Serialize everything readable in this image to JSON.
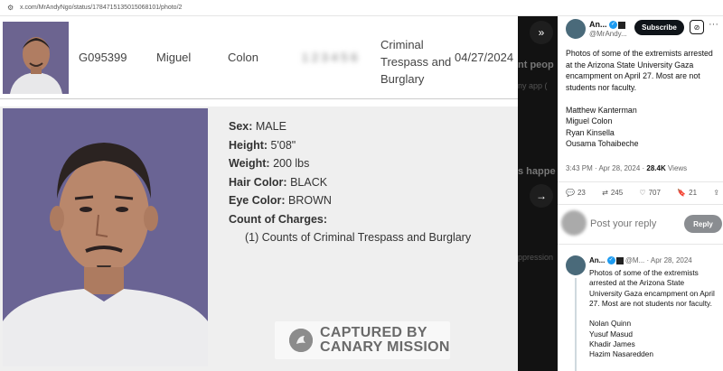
{
  "browser": {
    "url": "x.com/MrAndyNgo/status/1784715135015068101/photo/2"
  },
  "record_row": {
    "booking_id": "G095399",
    "first_name": "Miguel",
    "last_name": "Colon",
    "redacted": "1 2 3 4 5 6",
    "offense": "Criminal Trespass and Burglary",
    "date": "04/27/2024"
  },
  "details": {
    "sex_label": "Sex:",
    "sex": "MALE",
    "height_label": "Height:",
    "height": "5'08\"",
    "weight_label": "Weight:",
    "weight": "200 lbs",
    "hair_label": "Hair Color:",
    "hair": "BLACK",
    "eye_label": "Eye Color:",
    "eye": "BROWN",
    "charges_label": "Count of Charges:",
    "charge_1": "(1) Counts of Criminal Trespass and Burglary"
  },
  "watermark": {
    "line1": "CAPTURED BY",
    "line2": "CANARY MISSION"
  },
  "strip": {
    "ghost_1": "nt peop",
    "ghost_2": "ny app (",
    "ghost_3": "s happe",
    "ghost_4": "ppression"
  },
  "tweet": {
    "author_name": "An...",
    "author_handle": "@MrAndy...",
    "subscribe_label": "Subscribe",
    "text": "Photos of some of the extremists arrested at the Arizona State University Gaza encampment on April 27. Most are not students nor faculty.\n\nMatthew Kanterman\nMiguel Colon\nRyan Kinsella\nOusama Tohaibeche",
    "time": "3:43 PM · Apr 28, 2024 · ",
    "views_count": "28.4K",
    "views_label": " Views",
    "replies": "23",
    "reposts": "245",
    "likes": "707",
    "bookmarks": "21"
  },
  "reply_box": {
    "placeholder": "Post your reply",
    "button": "Reply"
  },
  "thread_reply": {
    "author_name": "An...",
    "handle_date": "@M... · Apr 28, 2024",
    "text": "Photos of some of the extremists arrested at the Arizona State University Gaza encampment on April 27. Most are not students nor faculty.\n\nNolan Quinn\nYusuf Masud\nKhadir James\nHazim Nasaredden"
  }
}
